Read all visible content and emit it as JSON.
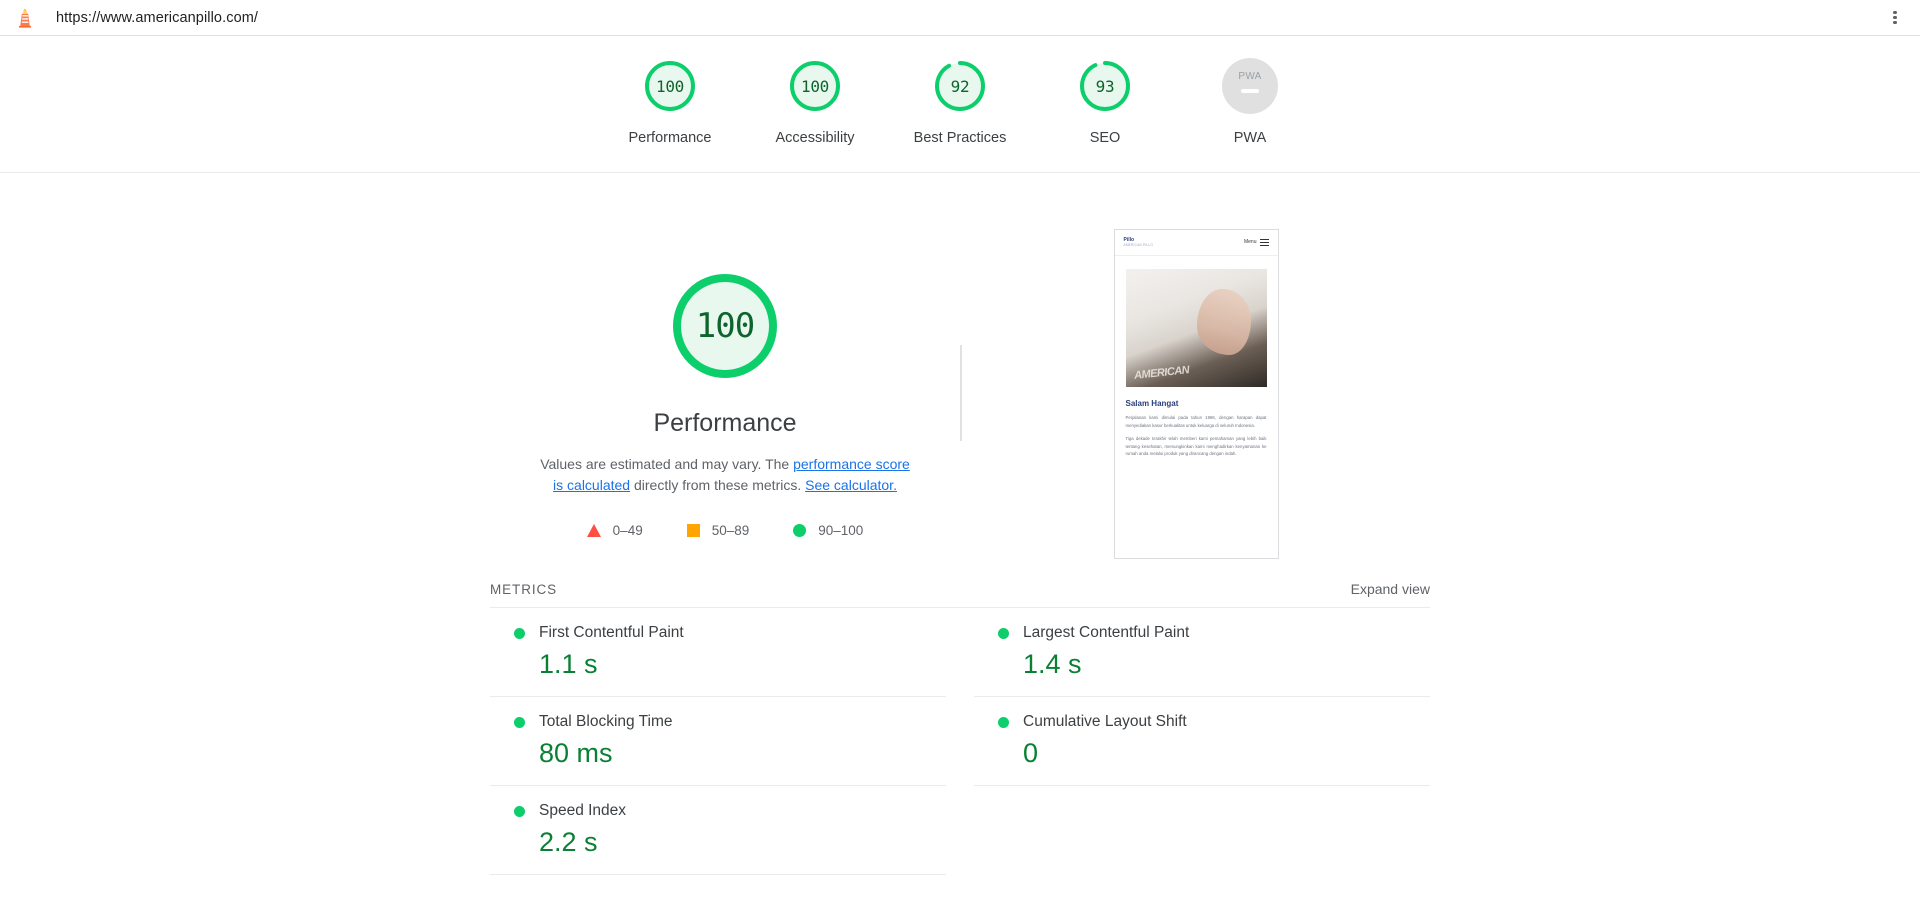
{
  "browser": {
    "url": "https://www.americanpillo.com/",
    "favicon_name": "lighthouse-icon",
    "menu_icon": "kebab-menu-icon"
  },
  "score_scale": [
    {
      "label": "Performance",
      "value": "100",
      "score": 100,
      "state": "pass"
    },
    {
      "label": "Accessibility",
      "value": "100",
      "score": 100,
      "state": "pass"
    },
    {
      "label": "Best Practices",
      "value": "92",
      "score": 92,
      "state": "pass"
    },
    {
      "label": "SEO",
      "value": "93",
      "score": 93,
      "state": "pass"
    },
    {
      "label": "PWA",
      "value": "PWA",
      "score": null,
      "state": "not-applicable"
    }
  ],
  "category": {
    "score": "100",
    "score_numeric": 100,
    "title": "Performance",
    "description_prefix": "Values are estimated and may vary. The ",
    "link1": "performance score is calculated",
    "description_mid": " directly from these metrics. ",
    "link2": "See calculator."
  },
  "legend": [
    {
      "icon": "triangle-icon",
      "range": "0–49",
      "color": "#ff4e42"
    },
    {
      "icon": "square-icon",
      "range": "50–89",
      "color": "#ffa400"
    },
    {
      "icon": "circle-icon",
      "range": "90–100",
      "color": "#0cce6b"
    }
  ],
  "screenshot_thumb": {
    "logo_line1": "Pillo",
    "logo_line2": "AMERICAN PILLO",
    "menu_label": "Menu",
    "menu_icon": "hamburger-icon",
    "hero_brand": "AMERICAN",
    "heading": "Salam Hangat",
    "paragraph1": "Perjalanan kami dimulai pada tahun 1986, dengan harapan dapat menyediakan kasur berkualitas untuk keluarga di seluruh Indonesia.",
    "paragraph2": "Tiga dekade terakhir telah memberi kami pemahaman yang lebih baik tentang kesehatan, memungkinkan kami menghadirkan kenyamanan ke rumah anda melalui produk yang dirancang dengan indah."
  },
  "metrics": {
    "section_title": "METRICS",
    "expand_label": "Expand view",
    "left_column": [
      {
        "name": "First Contentful Paint",
        "value": "1.1 s",
        "state": "pass"
      },
      {
        "name": "Total Blocking Time",
        "value": "80 ms",
        "state": "pass"
      },
      {
        "name": "Speed Index",
        "value": "2.2 s",
        "state": "pass"
      }
    ],
    "right_column": [
      {
        "name": "Largest Contentful Paint",
        "value": "1.4 s",
        "state": "pass"
      },
      {
        "name": "Cumulative Layout Shift",
        "value": "0",
        "state": "pass"
      }
    ]
  },
  "colors": {
    "pass": "#0cce6b",
    "average": "#ffa400",
    "fail": "#ff4e42",
    "pass_text": "#0d652d",
    "link": "#1a73e8",
    "na": "#e0e0e0"
  }
}
